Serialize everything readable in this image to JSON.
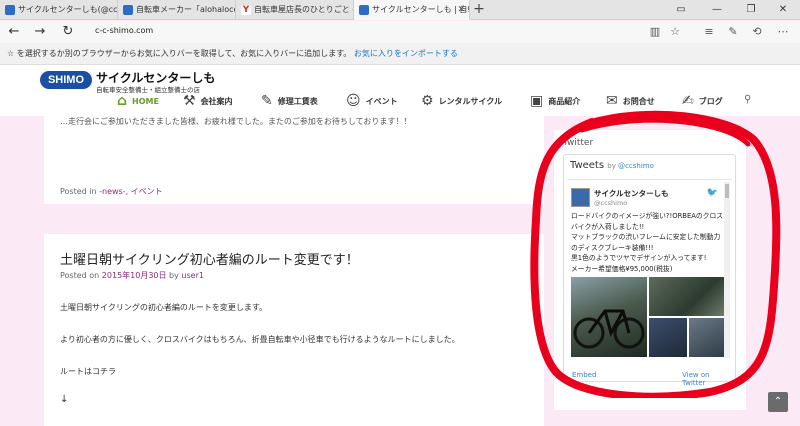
{
  "browser": {
    "tabs": [
      {
        "label": "サイクルセンターしも(@ccshimc",
        "color": "#2b6cc4",
        "active": false
      },
      {
        "label": "自転車メーカー「alohaloco」(@",
        "color": "#2b6cc4",
        "active": false
      },
      {
        "label": "自転車屋店長のひとりごと - Ya",
        "color": "#e0281f",
        "active": false
      },
      {
        "label": "サイクルセンターしも | 自転",
        "color": "#2b6cc4",
        "active": true
      }
    ],
    "url": "c-c-shimo.com",
    "favorites_message": "☆ を選択するか別のブラウザーからお気に入りバーを取得して、お気に入りバーに追加します。",
    "favorites_link": "お気に入りをインポートする"
  },
  "site": {
    "logo_badge": "SHIMO",
    "title": "サイクルセンターしも",
    "subtitle": "自転車安全整備士・組立整備士の店",
    "nav": [
      {
        "label": "HOME",
        "icon": "home-icon",
        "glyph": "⌂"
      },
      {
        "label": "会社案内",
        "icon": "wrench-icon",
        "glyph": "⚒"
      },
      {
        "label": "修理工賃表",
        "icon": "wrench-icon",
        "glyph": "✎"
      },
      {
        "label": "イベント",
        "icon": "people-icon",
        "glyph": "☺"
      },
      {
        "label": "レンタルサイクル",
        "icon": "gear-icon",
        "glyph": "⚙"
      },
      {
        "label": "商品紹介",
        "icon": "bag-icon",
        "glyph": "▣"
      },
      {
        "label": "お問合せ",
        "icon": "mail-icon",
        "glyph": "✉"
      },
      {
        "label": "ブログ",
        "icon": "edit-icon",
        "glyph": "✍"
      }
    ]
  },
  "posts": {
    "prev_excerpt": "…走行会にご参加いただきました皆様、お疲れ様でした。またのご参加をお待ちしております！！",
    "prev_posted_in_prefix": "Posted in ",
    "prev_categories": "-news-, イベント",
    "title": "土曜日朝サイクリング初心者編のルート変更です！",
    "meta_prefix": "Posted on ",
    "date": "2015年10月30日",
    "meta_by": " by ",
    "author": "user1",
    "paragraphs": [
      "土曜日朝サイクリングの初心者編のルートを変更します。",
      "より初心者の方に優しく、クロスバイクはもちろん、折畳自転車や小径車でも行けるようなルートにしました。",
      "ルートはコチラ",
      "↓"
    ]
  },
  "sidebar": {
    "heading": "Twitter",
    "widget_title": "Tweets",
    "widget_by": "by ",
    "widget_handle": "@ccshimo",
    "tweet_name": "サイクルセンターしも",
    "tweet_handle": "@ccshimo",
    "tweet_lines": [
      "ロードバイクのイメージが強い?!ORBEAのクロス",
      "バイクが入荷しました!!",
      "マットブラックの渋いフレームに安定した制動力",
      "のディスクブレーキ装備!!!",
      "黒1色のようでツヤでデザインが入ってます!",
      "メーカー希望価格¥95,000(税抜)"
    ],
    "embed": "Embed",
    "view_on": "View on Twitter"
  },
  "accent_colors": {
    "home": "#6a9a2a",
    "link": "#8c2c7c",
    "twitter": "#3a86c8",
    "highlight": "#e8001c"
  }
}
